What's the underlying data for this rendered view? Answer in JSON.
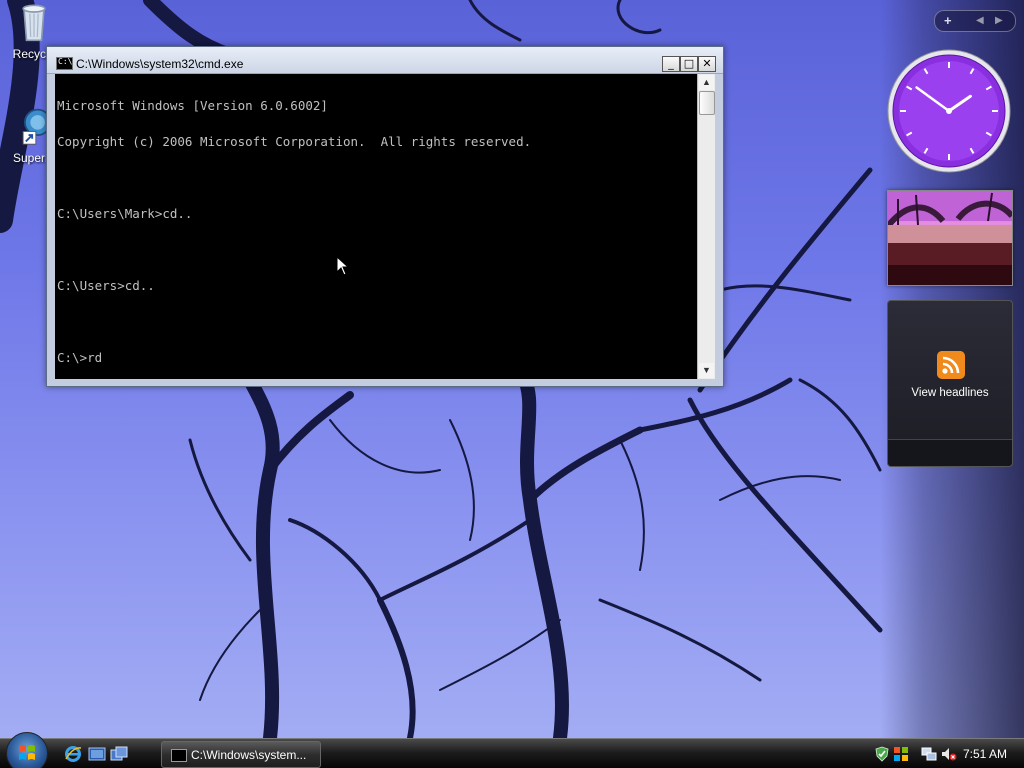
{
  "desktop": {
    "icons": [
      {
        "label": "Recycle",
        "icon": "recycle-bin-icon"
      },
      {
        "label": "Superm",
        "icon": "globe-shortcut-icon"
      }
    ]
  },
  "cmd": {
    "title": "C:\\Windows\\system32\\cmd.exe",
    "title_icon_text": "C:\\",
    "lines": [
      "Microsoft Windows [Version 6.0.6002]",
      "Copyright (c) 2006 Microsoft Corporation.  All rights reserved.",
      "",
      "C:\\Users\\Mark>cd..",
      "",
      "C:\\Users>cd..",
      "",
      "C:\\>rd"
    ],
    "buttons": {
      "minimize": "_",
      "maximize": "□",
      "close": "✕"
    }
  },
  "sidebar": {
    "controls": {
      "add": "+",
      "prev": "◀",
      "next": "▶"
    },
    "clock": {
      "hour": 1,
      "minute": 51
    },
    "feed": {
      "label": "View headlines",
      "icon": "rss-feed-icon"
    }
  },
  "taskbar": {
    "start_icon": "windows-start-orb-icon",
    "quick_launch": [
      "internet-explorer-icon",
      "show-desktop-icon",
      "switch-windows-icon"
    ],
    "tasks": [
      {
        "label": "C:\\Windows\\system...",
        "icon": "cmd-icon"
      }
    ],
    "tray_icons": [
      "security-center-icon",
      "network-icon",
      "volume-muted-icon"
    ],
    "clock": "7:51 AM"
  },
  "colors": {
    "console_bg": "#000000",
    "console_fg": "#c0c0c0",
    "clock_face": "#8a2fe0",
    "rss_orange": "#f08a1c"
  }
}
